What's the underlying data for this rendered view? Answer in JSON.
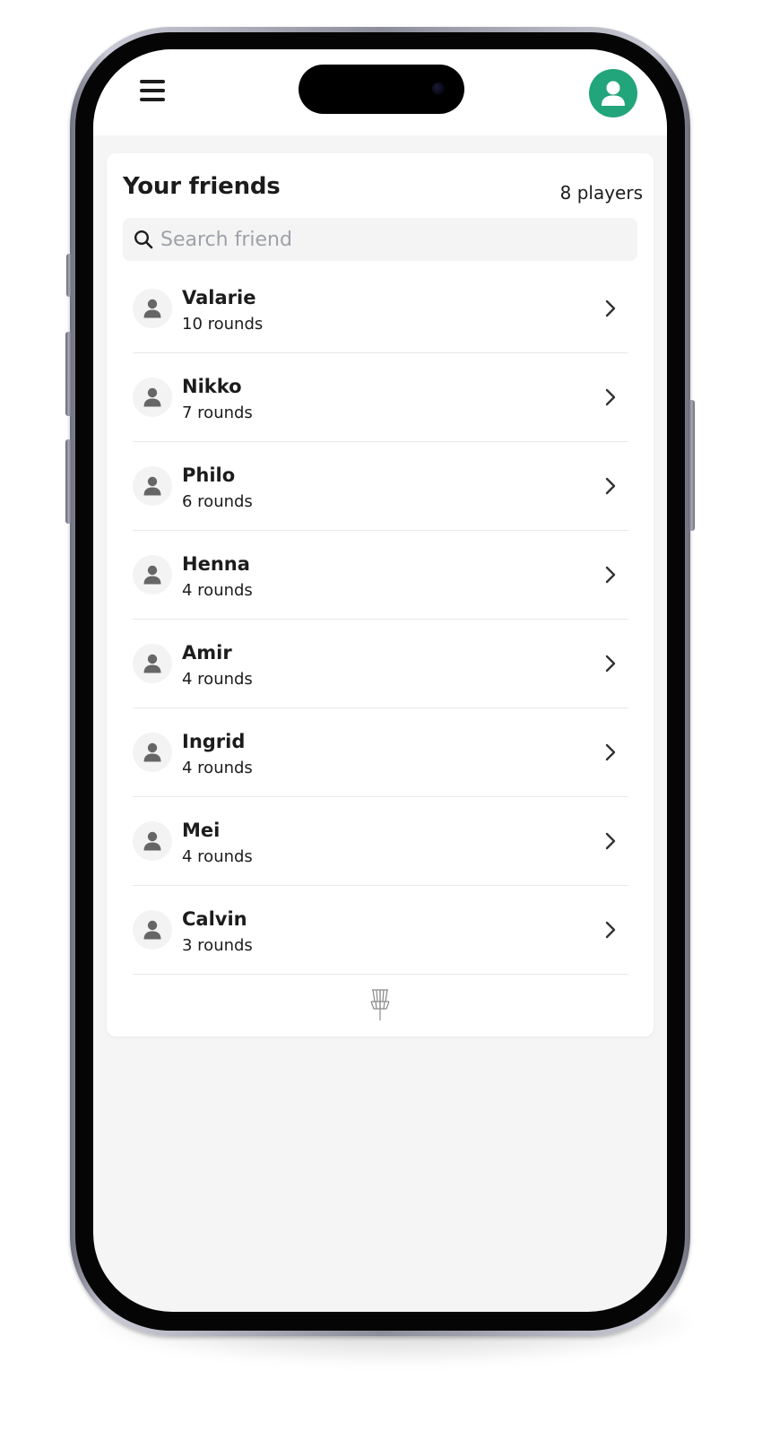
{
  "header": {
    "menu_icon": "hamburger-menu-icon",
    "profile_icon": "user-icon",
    "accent_color": "#22a57a"
  },
  "friends_card": {
    "title": "Your friends",
    "player_count": "8 players",
    "search": {
      "placeholder": "Search friend",
      "value": "",
      "icon": "search-icon"
    },
    "friends": [
      {
        "name": "Valarie",
        "rounds": "10 rounds"
      },
      {
        "name": "Nikko",
        "rounds": "7 rounds"
      },
      {
        "name": "Philo",
        "rounds": "6 rounds"
      },
      {
        "name": "Henna",
        "rounds": "4 rounds"
      },
      {
        "name": "Amir",
        "rounds": "4 rounds"
      },
      {
        "name": "Ingrid",
        "rounds": "4 rounds"
      },
      {
        "name": "Mei",
        "rounds": "4 rounds"
      },
      {
        "name": "Calvin",
        "rounds": "3 rounds"
      }
    ],
    "footer_icon": "disc-golf-basket-icon"
  }
}
